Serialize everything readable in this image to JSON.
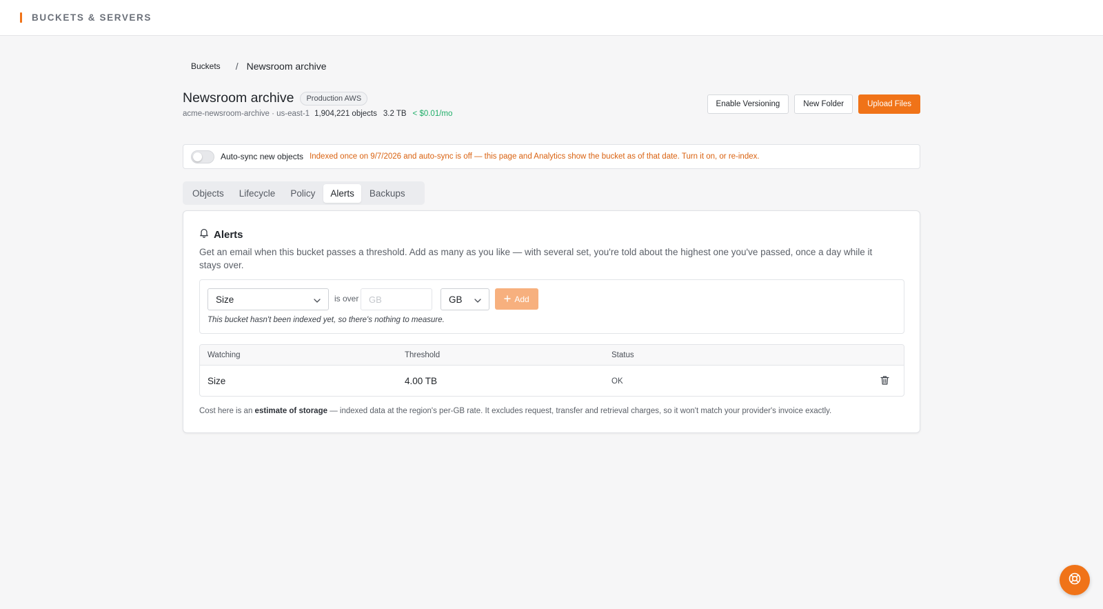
{
  "app": {
    "title": "BUCKETS & SERVERS"
  },
  "breadcrumb": {
    "root": "Buckets",
    "separator": "/",
    "current": "Newsroom archive"
  },
  "header": {
    "title": "Newsroom archive",
    "badge": "Production AWS",
    "bucket_id": "acme-newsroom-archive · us-east-1",
    "objects": "1,904,221 objects",
    "size": "3.2 TB",
    "cost": "< $0.01/mo"
  },
  "actions": {
    "enable_versioning": "Enable Versioning",
    "new_folder": "New Folder",
    "upload_files": "Upload Files"
  },
  "sync": {
    "label": "Auto-sync new objects",
    "enabled": false,
    "warning": "Indexed once on 9/7/2026 and auto-sync is off — this page and Analytics show the bucket as of that date. Turn it on, or re-index."
  },
  "tabs": [
    {
      "label": "Objects",
      "active": false
    },
    {
      "label": "Lifecycle",
      "active": false
    },
    {
      "label": "Policy",
      "active": false
    },
    {
      "label": "Alerts",
      "active": true
    },
    {
      "label": "Backups",
      "active": false
    }
  ],
  "alerts": {
    "title": "Alerts",
    "icon": "bell-icon",
    "description": "Get an email when this bucket passes a threshold. Add as many as you like — with several set, you're told about the highest one you've passed, once a day while it stays over.",
    "form": {
      "metric": "Size",
      "is_over": "is over",
      "value_placeholder": "GB",
      "value": "",
      "unit": "GB",
      "add_label": "Add",
      "note": "This bucket hasn't been indexed yet, so there's nothing to measure."
    },
    "table": {
      "headers": [
        "Watching",
        "Threshold",
        "Status"
      ],
      "rows": [
        {
          "watching": "Size",
          "threshold": "4.00 TB",
          "status": "OK"
        }
      ]
    },
    "footnote": {
      "prefix": "Cost here is an ",
      "bold": "estimate of storage",
      "suffix": " — indexed data at the region's per-GB rate. It excludes request, transfer and retrieval charges, so it won't match your provider's invoice exactly."
    }
  },
  "colors": {
    "accent": "#f07318",
    "accent_disabled": "#f7b07e",
    "warning_text": "#d9610f",
    "cost_text": "#1fae68",
    "background": "#f6f6f7"
  },
  "help": {
    "icon": "lifebuoy-icon"
  }
}
